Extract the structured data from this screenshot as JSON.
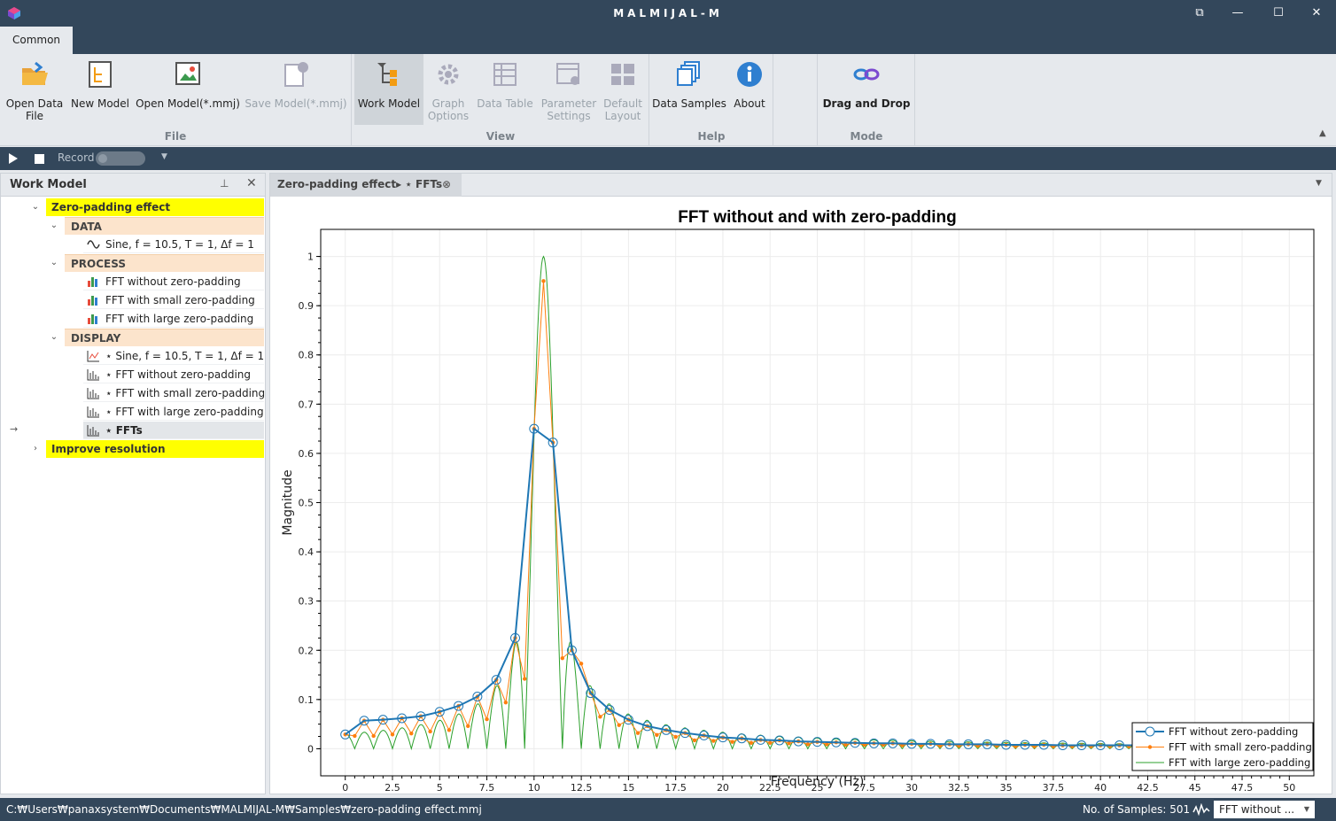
{
  "app": {
    "title": "MALMIJAL-M"
  },
  "ribbon": {
    "tab": "Common",
    "groups": {
      "file": "File",
      "view": "View",
      "help": "Help",
      "mode": "Mode"
    },
    "buttons": {
      "open_data_file": "Open Data\nFile",
      "new_model": "New Model",
      "open_model": "Open Model(*.mmj)",
      "save_model": "Save Model(*.mmj)",
      "work_model": "Work Model",
      "graph_options": "Graph\nOptions",
      "data_table": "Data Table",
      "parameter_settings": "Parameter\nSettings",
      "default_layout": "Default\nLayout",
      "data_samples": "Data Samples",
      "about": "About",
      "drag_and_drop": "Drag and Drop"
    }
  },
  "recordbar": {
    "label": "Record"
  },
  "work_model": {
    "title": "Work Model",
    "groups": [
      "Zero-padding effect",
      "Improve resolution"
    ],
    "categories": [
      "DATA",
      "PROCESS",
      "DISPLAY"
    ],
    "data_items": [
      "Sine, f = 10.5, T = 1, Δf = 1"
    ],
    "process_items": [
      "FFT without zero-padding",
      "FFT with small zero-padding",
      "FFT with large zero-padding"
    ],
    "display_items": [
      "⋆ Sine, f = 10.5, T = 1, Δf = 1",
      "⋆ FFT without zero-padding",
      "⋆ FFT with small zero-padding",
      "⋆ FFT with large zero-padding",
      "⋆ FFTs"
    ]
  },
  "doc_tab": {
    "label": "Zero-padding effect▸ ⋆ FFTs"
  },
  "status": {
    "path": "C:₩Users₩panaxsystem₩Documents₩MALMIJAL-M₩Samples₩zero-padding effect.mmj",
    "samples": "No. of Samples: 501",
    "selector": "FFT without ..."
  },
  "colors": {
    "titlebar": "#33475b",
    "group_highlight": "#ffff00",
    "category_bg": "#fce4cc",
    "series_blue": "#1f77b4",
    "series_orange": "#ff7f0e",
    "series_green": "#2ca02c"
  },
  "chart_data": {
    "type": "line",
    "title": "FFT without and with zero-padding",
    "xlabel": "Frequency (Hz)",
    "ylabel": "Magnitude",
    "xlim": [
      -1.3,
      51.3
    ],
    "ylim": [
      -0.055,
      1.055
    ],
    "xticks": [
      0,
      2.5,
      5,
      7.5,
      10,
      12.5,
      15,
      17.5,
      20,
      22.5,
      25,
      27.5,
      30,
      32.5,
      35,
      37.5,
      40,
      42.5,
      45,
      47.5,
      50
    ],
    "xticklabels": [
      "0",
      "2.5",
      "5",
      "7.5",
      "10",
      "12.5",
      "15",
      "17.5",
      "20",
      "22.5",
      "25",
      "27.5",
      "30",
      "32.5",
      "35",
      "37.5",
      "40",
      "42.5",
      "45",
      "47.5",
      "50"
    ],
    "yticks": [
      0,
      0.1,
      0.2,
      0.3,
      0.4,
      0.5,
      0.6,
      0.7,
      0.8,
      0.9,
      1
    ],
    "yticklabels": [
      "0",
      "0.1",
      "0.2",
      "0.3",
      "0.4",
      "0.5",
      "0.6",
      "0.7",
      "0.8",
      "0.9",
      "1"
    ],
    "grid": true,
    "legend_position": "bottom-right",
    "series": [
      {
        "name": "FFT without zero-padding",
        "color": "#1f77b4",
        "x": [
          0,
          1,
          2,
          3,
          4,
          5,
          6,
          7,
          8,
          9,
          10,
          11,
          12,
          13,
          14,
          15,
          16,
          17,
          18,
          19,
          20,
          21,
          22,
          23,
          24,
          25,
          26,
          27,
          28,
          29,
          30,
          31,
          32,
          33,
          34,
          35,
          36,
          37,
          38,
          39,
          40,
          41,
          42,
          43,
          44,
          45,
          46,
          47,
          48,
          49,
          50
        ],
        "y": [
          0.029,
          0.057,
          0.059,
          0.062,
          0.066,
          0.075,
          0.087,
          0.106,
          0.14,
          0.225,
          0.65,
          0.622,
          0.2,
          0.113,
          0.079,
          0.059,
          0.046,
          0.038,
          0.032,
          0.027,
          0.023,
          0.021,
          0.018,
          0.017,
          0.015,
          0.014,
          0.013,
          0.012,
          0.011,
          0.011,
          0.01,
          0.01,
          0.009,
          0.009,
          0.009,
          0.008,
          0.008,
          0.008,
          0.007,
          0.007,
          0.007,
          0.007,
          0.007,
          0.006,
          0.006,
          0.006,
          0.006,
          0.006,
          0.006,
          0.006,
          0.006
        ]
      },
      {
        "name": "FFT with small zero-padding",
        "color": "#ff7f0e",
        "x": [
          0,
          0.5,
          1,
          1.5,
          2,
          2.5,
          3,
          3.5,
          4,
          4.5,
          5,
          5.5,
          6,
          6.5,
          7,
          7.5,
          8,
          8.5,
          9,
          9.5,
          10,
          10.5,
          11,
          11.5,
          12,
          12.5,
          13,
          13.5,
          14,
          14.5,
          15,
          15.5,
          16,
          16.5,
          17,
          17.5,
          18,
          18.5,
          19,
          19.5,
          20,
          20.5,
          21,
          21.5,
          22,
          22.5,
          23,
          23.5,
          24,
          24.5,
          25,
          25.5,
          26,
          26.5,
          27,
          27.5,
          28,
          28.5,
          29,
          29.5,
          30,
          30.5,
          31,
          31.5,
          32,
          32.5,
          33,
          33.5,
          34,
          34.5,
          35,
          35.5,
          36,
          36.5,
          37,
          37.5,
          38,
          38.5,
          39,
          39.5,
          40,
          40.5,
          41,
          41.5,
          42,
          42.5,
          43,
          43.5,
          44,
          44.5,
          45,
          45.5,
          46,
          46.5,
          47,
          47.5,
          48,
          48.5,
          49,
          49.5,
          50
        ],
        "y": [
          0.029,
          0.026,
          0.057,
          0.026,
          0.059,
          0.029,
          0.062,
          0.031,
          0.066,
          0.035,
          0.075,
          0.038,
          0.087,
          0.046,
          0.106,
          0.06,
          0.14,
          0.094,
          0.225,
          0.142,
          0.65,
          0.95,
          0.622,
          0.184,
          0.2,
          0.173,
          0.113,
          0.065,
          0.079,
          0.048,
          0.059,
          0.032,
          0.046,
          0.028,
          0.038,
          0.024,
          0.032,
          0.017,
          0.027,
          0.016,
          0.023,
          0.014,
          0.021,
          0.012,
          0.018,
          0.012,
          0.017,
          0.011,
          0.015,
          0.009,
          0.014,
          0.009,
          0.013,
          0.008,
          0.012,
          0.008,
          0.011,
          0.008,
          0.011,
          0.007,
          0.01,
          0.007,
          0.01,
          0.006,
          0.009,
          0.006,
          0.009,
          0.006,
          0.009,
          0.006,
          0.008,
          0.005,
          0.008,
          0.005,
          0.008,
          0.005,
          0.007,
          0.005,
          0.007,
          0.005,
          0.007,
          0.005,
          0.007,
          0.005,
          0.007,
          0.005,
          0.006,
          0.005,
          0.006,
          0.005,
          0.006,
          0.005,
          0.006,
          0.005,
          0.006,
          0.005,
          0.006,
          0.005,
          0.006,
          0.005,
          0.006
        ]
      },
      {
        "name": "FFT with large zero-padding",
        "color": "#2ca02c",
        "curve": "sinc envelope, peak 1.0 at 10.5 Hz, nulls every 1 Hz",
        "peak_x": 10.5,
        "peak_y": 1.0
      }
    ]
  }
}
